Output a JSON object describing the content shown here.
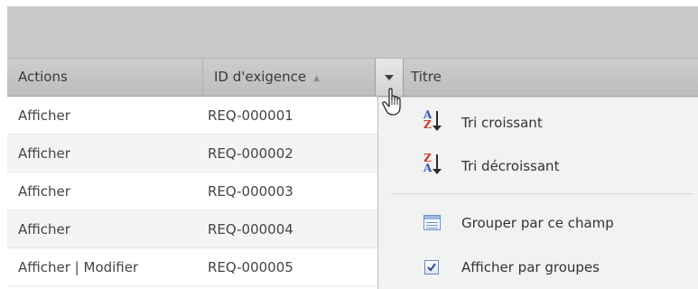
{
  "grid": {
    "columns": {
      "actions": "Actions",
      "req_id": "ID d'exigence",
      "title": "Titre"
    },
    "sort_indicator": "▲",
    "rows": [
      {
        "actions": "Afficher",
        "req_id": "REQ-000001"
      },
      {
        "actions": "Afficher",
        "req_id": "REQ-000002"
      },
      {
        "actions": "Afficher",
        "req_id": "REQ-000003"
      },
      {
        "actions": "Afficher",
        "req_id": "REQ-000004"
      },
      {
        "actions": "Afficher | Modifier",
        "req_id": "REQ-000005"
      }
    ]
  },
  "column_menu": {
    "sort_asc": "Tri croissant",
    "sort_desc": "Tri décroissant",
    "group_by": "Grouper par ce champ",
    "show_groups": "Afficher par groupes",
    "show_groups_checked": true
  },
  "icons": {
    "dropdown": "chevron-down-icon",
    "sort_asc": "sort-ascending-icon",
    "sort_desc": "sort-descending-icon",
    "group": "group-by-icon",
    "checkbox": "checkbox-checked-icon",
    "cursor": "hand-pointer-icon"
  }
}
